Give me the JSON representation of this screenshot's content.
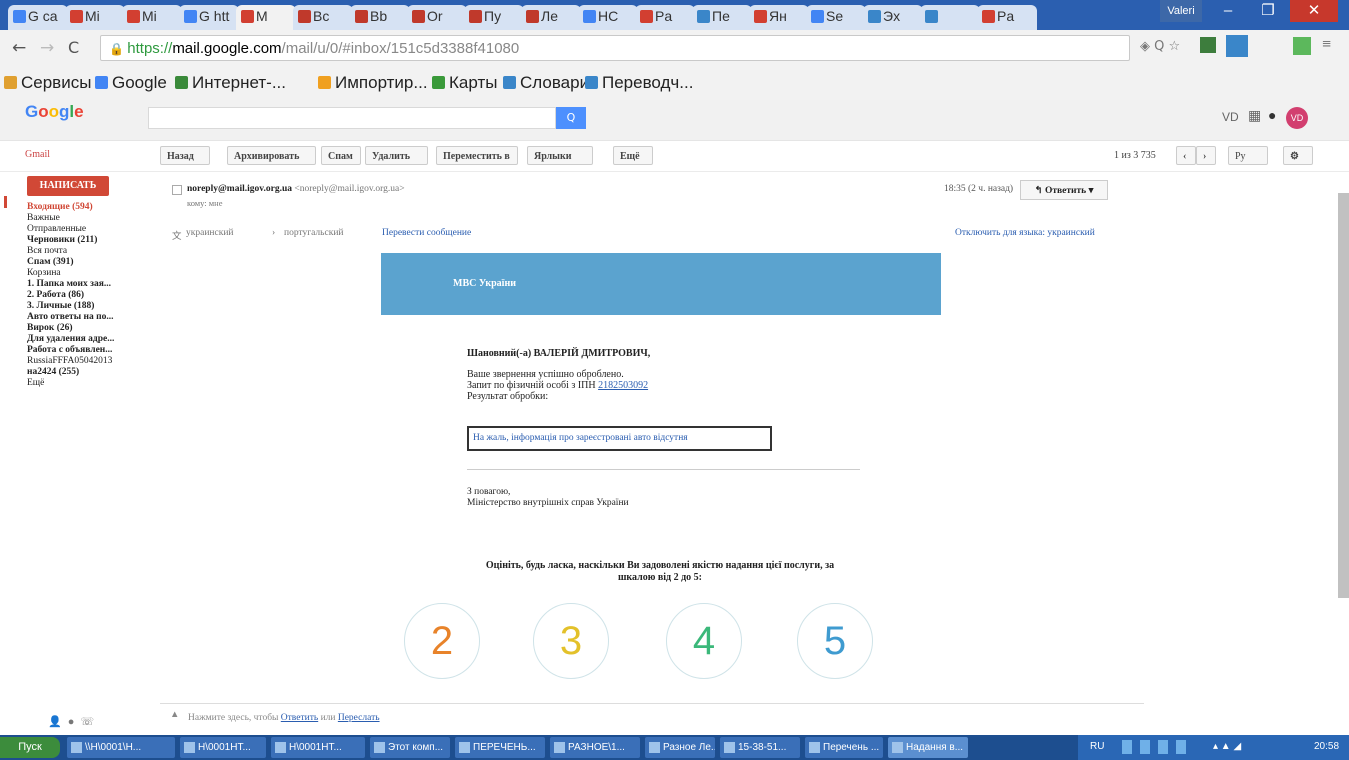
{
  "browser": {
    "tabs": [
      "G ca",
      "Mi",
      "Mi",
      "G htt",
      "M",
      "Bc",
      "Bb",
      "Or",
      "Пу",
      "Ле",
      "HC",
      "Pa",
      "Пе",
      "Ян",
      "Se",
      "Эх",
      "",
      "Pa"
    ],
    "active_tab_index": 4,
    "profile_label": "Valeri",
    "url_prefix": "https://",
    "url_host": "mail.google.com",
    "url_path": "/mail/u/0/#inbox/151c5d3388f41080",
    "bookmarks": [
      "Сервисы",
      "Google",
      "Интернет-...",
      "Импортир...",
      "Карты",
      "Словари",
      "Переводч..."
    ]
  },
  "gmail_header": {
    "logo": "Google",
    "search_button": "Q",
    "avatar": "VD",
    "user_short": "VD"
  },
  "toolbar": {
    "gmail_label": "Gmail",
    "buttons": [
      "Назад",
      "Архивировать",
      "Спам",
      "Удалить",
      "Переместить в",
      "Ярлыки",
      "Ещё"
    ],
    "pager": "1 из 3 735",
    "lang": "Ру"
  },
  "sidebar": {
    "compose": "НАПИСАТЬ",
    "items": [
      {
        "label": "Входящие (594)",
        "style": "active"
      },
      {
        "label": "Важные",
        "style": ""
      },
      {
        "label": "Отправленные",
        "style": ""
      },
      {
        "label": "Черновики (211)",
        "style": "bold"
      },
      {
        "label": "Вся почта",
        "style": ""
      },
      {
        "label": "Спам (391)",
        "style": "bold"
      },
      {
        "label": "Корзина",
        "style": ""
      },
      {
        "label": "1. Папка моих зая...",
        "style": "bold"
      },
      {
        "label": "2. Работа (86)",
        "style": "bold"
      },
      {
        "label": "3. Личные (188)",
        "style": "bold"
      },
      {
        "label": "Авто ответы на по...",
        "style": "bold"
      },
      {
        "label": "Вирок (26)",
        "style": "bold"
      },
      {
        "label": "Для удаления адре...",
        "style": "bold"
      },
      {
        "label": "Работа с объявлен...",
        "style": "bold"
      },
      {
        "label": "RussiaFFFA05042013",
        "style": ""
      },
      {
        "label": "на2424 (255)",
        "style": "bold"
      },
      {
        "label": "Ещё",
        "style": ""
      }
    ]
  },
  "message": {
    "sender_name": "noreply@mail.igov.org.ua",
    "sender_email": "<noreply@mail.igov.org.ua>",
    "to": "кому: мне",
    "time": "18:35 (2 ч. назад)",
    "reply_button": "Ответить",
    "translate_from": "украинский",
    "translate_to": "португальский",
    "translate_link": "Перевести сообщение",
    "disable_translate": "Отключить для языка: украинский"
  },
  "email": {
    "banner_title": "МВС України",
    "greeting": "Шановний(-а) ВАЛЕРІЙ ДМИТРОВИЧ,",
    "line1": "Ваше звернення успішно оброблено.",
    "line2_prefix": "Запит по фізичній особі з ІПН ",
    "line2_link": "2182503092",
    "line3": "Результат обробки:",
    "info_box": "На жаль, інформація про зареєстровані авто відсутня",
    "closing1": "З повагою,",
    "closing2": "Міністерство внутрішніх справ України",
    "rate_text": "Оцініть, будь ласка, наскільки Ви задоволені якістю надання цієї послуги, за шкалою від 2 до 5:",
    "ratings": [
      {
        "value": "2",
        "color": "#e8832a"
      },
      {
        "value": "3",
        "color": "#e3c12a"
      },
      {
        "value": "4",
        "color": "#3bb87a"
      },
      {
        "value": "5",
        "color": "#3f9bd0"
      }
    ]
  },
  "reply_box": {
    "prefix": "Нажмите здесь, чтобы ",
    "reply_link": "Ответить",
    "mid": " или ",
    "forward_link": "Переслать"
  },
  "taskbar": {
    "start": "Пуск",
    "items": [
      "\\\\H\\0001\\H...",
      "H\\0001HT...",
      "H\\0001HT...",
      "Этот комп...",
      "ПЕРЕЧЕНЬ...",
      "РАЗНОЕ\\1...",
      "Разное Ле...",
      "15-38-51...",
      "Перечень ...",
      "Надання в..."
    ],
    "lang": "RU",
    "clock": "20:58"
  }
}
